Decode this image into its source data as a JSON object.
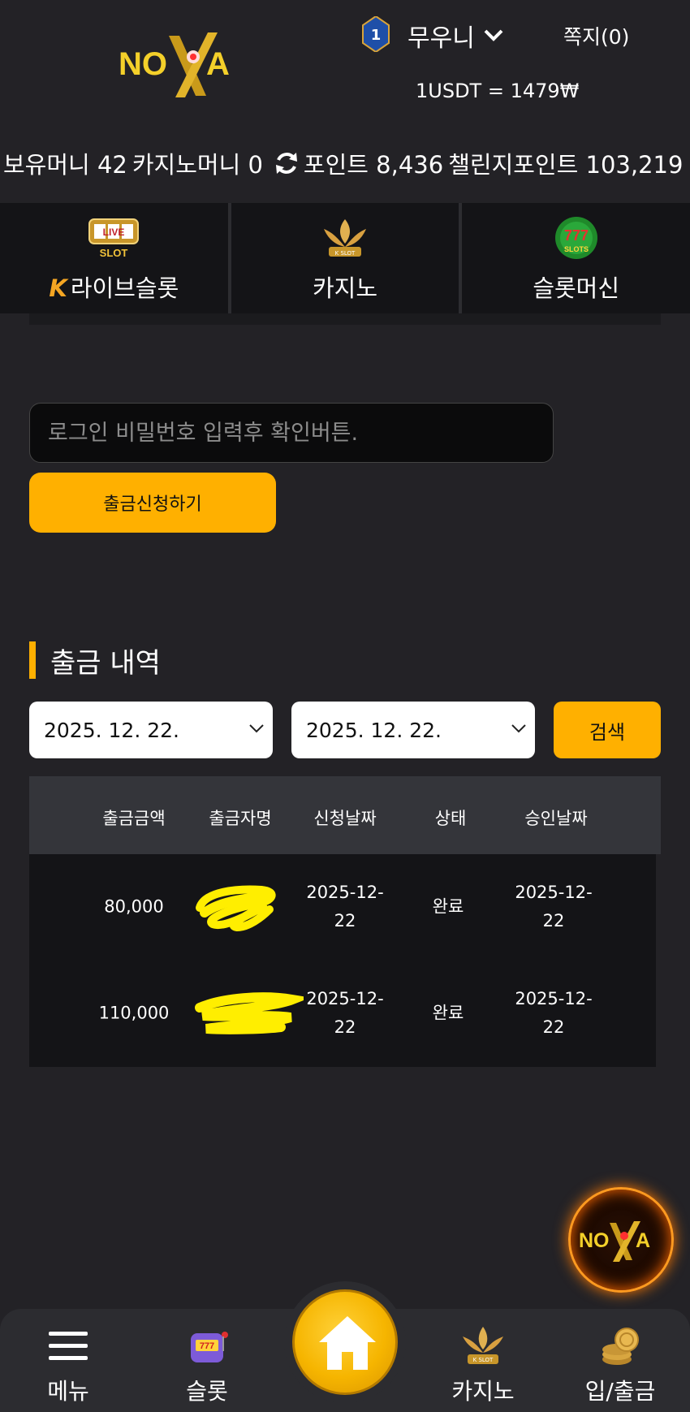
{
  "header": {
    "logo_text": "NOVA",
    "rank_level": "1",
    "username": "무우니",
    "messages_label": "쪽지(0)",
    "exchange_rate": "1USDT = 1479₩"
  },
  "balances": {
    "holding_money": "보유머니 42",
    "casino_money": "카지노머니 0",
    "points": "포인트 8,436",
    "challenge_points": "챌린지포인트 103,219"
  },
  "categories": [
    {
      "label": "라이브슬롯",
      "icon": "live-slot-icon"
    },
    {
      "label": "카지노",
      "icon": "k-slot-icon"
    },
    {
      "label": "슬롯머신",
      "icon": "777-slots-icon"
    }
  ],
  "withdraw": {
    "password_placeholder": "로그인 비밀번호 입력후 확인버튼.",
    "apply_label": "출금신청하기"
  },
  "history": {
    "title": "출금 내역",
    "start_date": "2025. 12. 22.",
    "end_date": "2025. 12. 22.",
    "search_label": "검색",
    "columns": [
      "출금금액",
      "출금자명",
      "신청날짜",
      "상태",
      "승인날짜"
    ],
    "rows": [
      {
        "amount": "80,000",
        "request_date_1": "2025-12-",
        "request_date_2": "22",
        "status": "완료",
        "approve_date_1": "2025-12-",
        "approve_date_2": "22"
      },
      {
        "amount": "110,000",
        "request_date_1": "2025-12-",
        "request_date_2": "22",
        "status": "완료",
        "approve_date_1": "2025-12-",
        "approve_date_2": "22"
      }
    ]
  },
  "bottom_nav": {
    "menu": "메뉴",
    "slot": "슬롯",
    "casino": "카지노",
    "deposit_withdraw": "입/출금"
  },
  "colors": {
    "accent": "#ffb000",
    "background": "#232226",
    "dark_panel": "#141417"
  }
}
